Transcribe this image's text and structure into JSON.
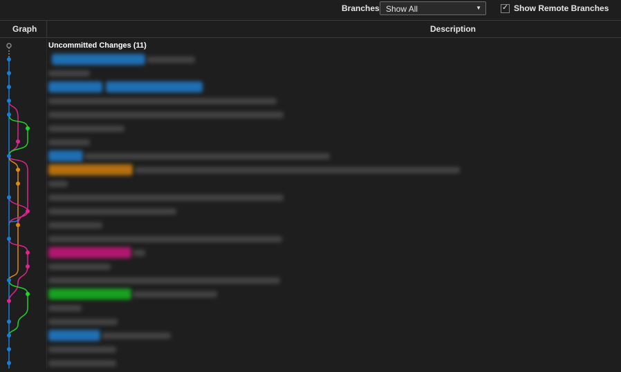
{
  "toolbar": {
    "branches_label": "Branches:",
    "branches_value": "Show All",
    "remote_checked": true,
    "remote_label": "Show Remote Branches"
  },
  "header": {
    "graph": "Graph",
    "description": "Description"
  },
  "uncommitted": "Uncommitted Changes (11)",
  "colors": {
    "blue": "#1a7fd4",
    "pink": "#e0248f",
    "green": "#1fd42a",
    "orange": "#e08a10"
  },
  "icons": [
    "chevron-down-icon",
    "checkmark-icon"
  ]
}
